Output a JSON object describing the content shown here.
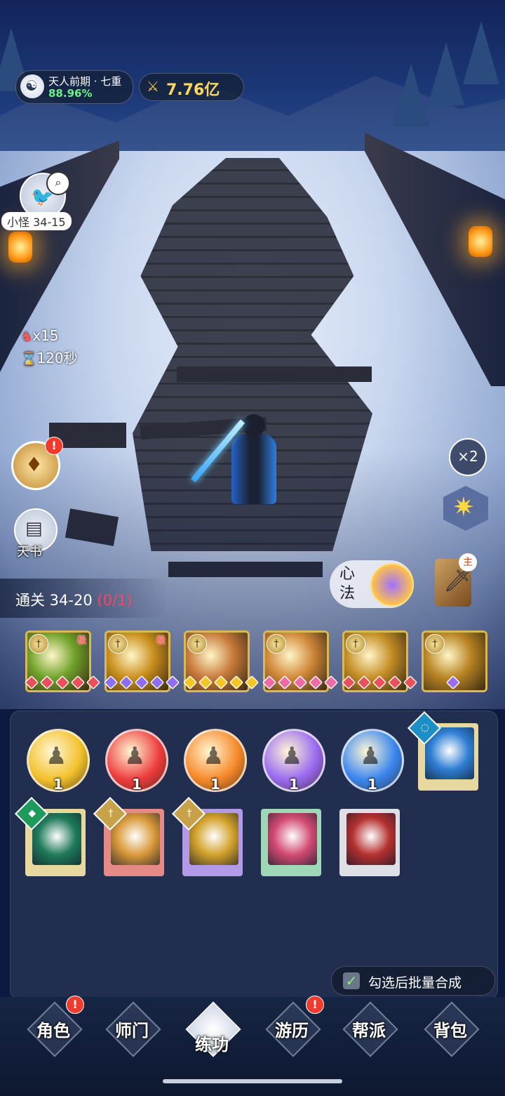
{
  "hud": {
    "realm": "天人前期 · 七重",
    "realm_progress": "88.96%",
    "power": "7.76亿"
  },
  "left_panel": {
    "stage_label": "小怪 34-15",
    "monster_count": "x15",
    "timer": "120秒",
    "tianshu_label": "天书"
  },
  "right_panel": {
    "speed_label": "×2",
    "xinfa_label": "心法",
    "main_tag": "主"
  },
  "progress": {
    "prefix": "通关 34-20",
    "count": "(0/1)"
  },
  "equipped_skills": [
    {
      "name": "green-wind",
      "marker": "极",
      "color": "#6fa22a",
      "gem_color": "#e9505a",
      "gems": 5
    },
    {
      "name": "golden-stars",
      "marker": "极",
      "color": "#c98e1c",
      "gem_color": "#8e6ef0",
      "gems": 5
    },
    {
      "name": "pink-sword",
      "marker": "",
      "color": "#c87a3a",
      "gem_color": "#f3c623",
      "gems": 5
    },
    {
      "name": "blue-comet",
      "marker": "",
      "color": "#d1883a",
      "gem_color": "#ee6aa7",
      "gems": 5
    },
    {
      "name": "gold-slash",
      "marker": "",
      "color": "#c58e26",
      "gem_color": "#e9505a",
      "gems": 5
    },
    {
      "name": "gold-burst",
      "marker": "",
      "color": "#b98423",
      "gem_color": "#9a6ef2",
      "gems": 1
    }
  ],
  "orbs": [
    {
      "color": "#f3c12c",
      "count": "1"
    },
    {
      "color": "#ee3d3d",
      "count": "1"
    },
    {
      "color": "#f6892a",
      "count": "1"
    },
    {
      "color": "#9a6af0",
      "count": "1"
    },
    {
      "color": "#3a86ef",
      "count": "1"
    }
  ],
  "scrolls": [
    {
      "frame": "#e7d8a0",
      "inner": "#2f7fd4",
      "badge": "#1d8fc7",
      "badge_icon": "◌"
    },
    {
      "frame": "#e7d8a0",
      "inner": "#1f7a5a",
      "badge": "#1e9a5a",
      "badge_icon": "◆"
    },
    {
      "frame": "#e58a86",
      "inner": "#d99a3a",
      "badge": "#c8a24a",
      "badge_icon": "†"
    },
    {
      "frame": "#b39ae8",
      "inner": "#d2a12a",
      "badge": "#c8a24a",
      "badge_icon": "†"
    },
    {
      "frame": "#9fd8b7",
      "inner": "#d24a72",
      "badge": "",
      "badge_icon": ""
    },
    {
      "frame": "#dfdfe6",
      "inner": "#b4302f",
      "badge": "",
      "badge_icon": ""
    }
  ],
  "batch": {
    "label": "勾选后批量合成"
  },
  "nav": {
    "tabs": [
      "角色",
      "师门",
      "练功",
      "游历",
      "帮派",
      "背包"
    ],
    "active": "练功"
  }
}
